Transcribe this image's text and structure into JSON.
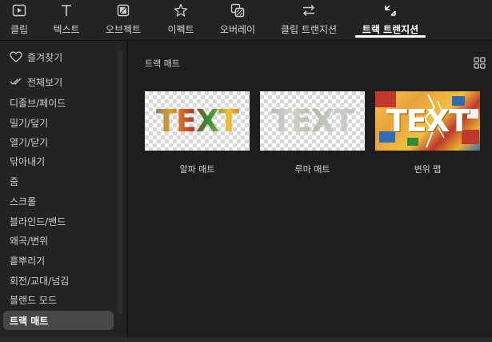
{
  "toolbar": {
    "tabs": [
      {
        "label": "클립",
        "icon": "clip-icon"
      },
      {
        "label": "텍스트",
        "icon": "text-icon"
      },
      {
        "label": "오브젝트",
        "icon": "object-icon"
      },
      {
        "label": "이펙트",
        "icon": "effect-icon"
      },
      {
        "label": "오버레이",
        "icon": "overlay-icon"
      },
      {
        "label": "클립 트랜지션",
        "icon": "clip-transition-icon"
      },
      {
        "label": "트랙 트랜지션",
        "icon": "track-transition-icon"
      }
    ],
    "active_tab": "트랙 트랜지션"
  },
  "sidebar": {
    "items": [
      {
        "label": "즐겨찾기",
        "icon": "heart-icon"
      },
      {
        "label": "전체보기",
        "icon": "check-double-icon"
      },
      {
        "label": "디졸브/페이드"
      },
      {
        "label": "밀기/덮기"
      },
      {
        "label": "열기/닫기"
      },
      {
        "label": "닦아내기"
      },
      {
        "label": "줌"
      },
      {
        "label": "스크롤"
      },
      {
        "label": "블라인드/밴드"
      },
      {
        "label": "왜곡/변위"
      },
      {
        "label": "흩뿌리기"
      },
      {
        "label": "회전/교대/넘김"
      },
      {
        "label": "블랜드 모드"
      },
      {
        "label": "트랙 매트"
      }
    ],
    "active_item": "트랙 매트"
  },
  "main": {
    "section_title": "트랙 매트",
    "cards": [
      {
        "label": "알파 매트",
        "thumb_text": "TEXT"
      },
      {
        "label": "루마 매트",
        "thumb_text": "TEXT"
      },
      {
        "label": "변위 맵",
        "thumb_text": "TEXT"
      }
    ]
  },
  "colors": {
    "background": "#1e1e1e",
    "sidebar": "#232323",
    "active_item": "#474747",
    "accent": "#ffffff"
  }
}
